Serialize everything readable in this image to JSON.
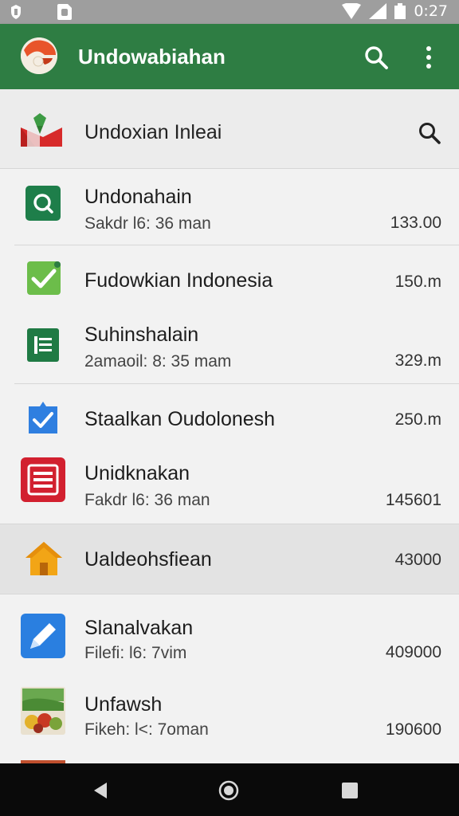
{
  "status_bar": {
    "time": "0:27"
  },
  "app_bar": {
    "title": "Undowabiahan",
    "icons": [
      "app-logo-icon",
      "search-icon",
      "more-vert-icon"
    ]
  },
  "search_row": {
    "label": "Undoxian Inleai",
    "icons": [
      "flag-icon",
      "search-icon"
    ]
  },
  "list": [
    {
      "title": "Undonahain",
      "sub": "Sakdr l6: 36 man",
      "value": "133.00",
      "icon": "search-app-icon"
    },
    {
      "title": "Fudowkian Indonesia",
      "sub": "",
      "value": "150.m",
      "icon": "checkbox-icon"
    },
    {
      "title": "Suhinshalain",
      "sub": "2amaoil: 8: 35 mam",
      "value": "329.m",
      "icon": "list-doc-icon"
    },
    {
      "title": "Staalkan Oudolonesh",
      "sub": "",
      "value": "250.m",
      "icon": "check-shield-icon"
    },
    {
      "title": "Unidknakan",
      "sub": "Fakdr l6: 36 man",
      "value": "145601",
      "icon": "document-icon"
    },
    {
      "title": "Ualdeohsfiean",
      "sub": "",
      "value": "43000",
      "icon": "home-icon"
    },
    {
      "title": "Slanalvakan",
      "sub": "Filefi: l6: 7vim",
      "value": "409000",
      "icon": "pen-icon"
    },
    {
      "title": "Unfawsh",
      "sub": "Fikeh: l<: 7oman",
      "value": "190600",
      "icon": "food-photo-icon"
    }
  ],
  "nav_bar": {
    "icons": [
      "back-icon",
      "home-circle-icon",
      "recents-icon"
    ]
  },
  "colors": {
    "app_bar": "#2e7d43",
    "status_bar": "#9e9e9e",
    "highlight": "#e3e3e3"
  }
}
